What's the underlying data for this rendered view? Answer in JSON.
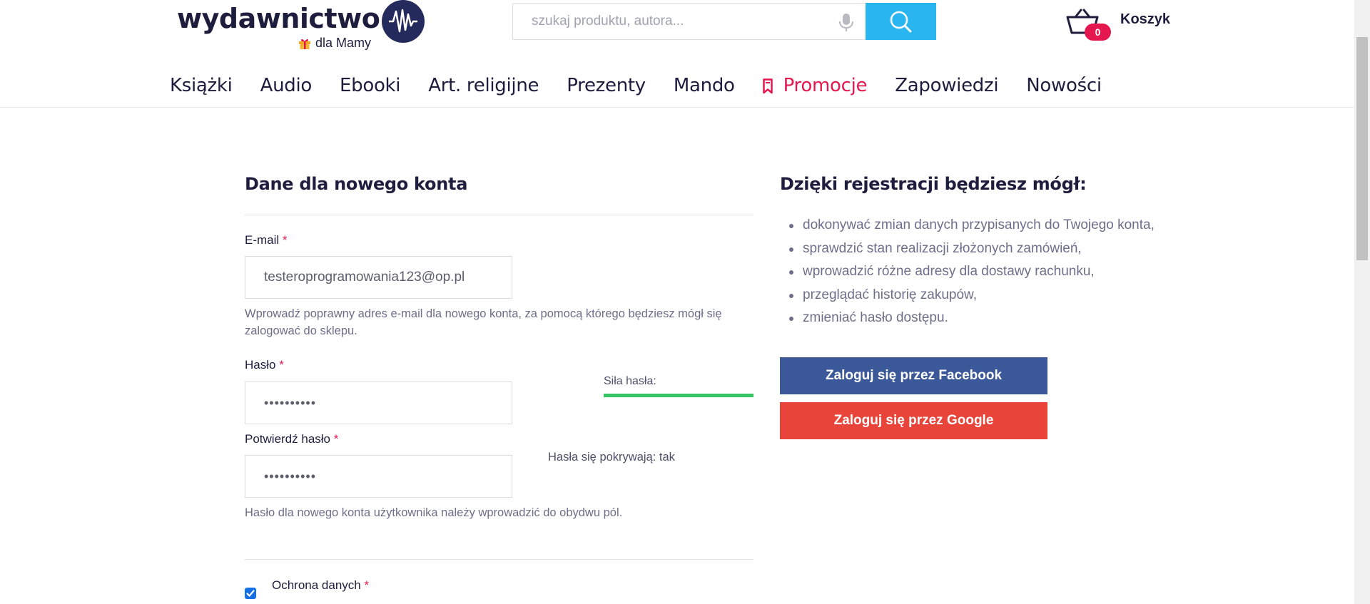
{
  "header": {
    "logo_text": "wydawnictwo",
    "logo_subtitle": "dla Mamy",
    "search": {
      "placeholder": "szukaj produktu, autora..."
    },
    "cart": {
      "label": "Koszyk",
      "count": "0"
    }
  },
  "nav": {
    "items": [
      "Książki",
      "Audio",
      "Ebooki",
      "Art. religijne",
      "Prezenty",
      "Mando",
      "Promocje",
      "Zapowiedzi",
      "Nowości"
    ]
  },
  "form": {
    "title": "Dane dla nowego konta",
    "email": {
      "label": "E-mail",
      "value": "testeroprogramowania123@op.pl",
      "help": "Wprowadź poprawny adres e-mail dla nowego konta, za pomocą którego będziesz mógł się zalogować do sklepu."
    },
    "password": {
      "label": "Hasło",
      "value": "••••••••••",
      "strength_label": "Siła hasła:",
      "strength": 1.0
    },
    "confirm": {
      "label": "Potwierdź hasło",
      "value": "••••••••••",
      "match_text": "Hasła się pokrywają: tak",
      "help": "Hasło dla nowego konta użytkownika należy wprowadzić do obydwu pól."
    },
    "required_mark": "*",
    "privacy": {
      "label": "Ochrona danych",
      "checked": true
    }
  },
  "benefits": {
    "title": "Dzięki rejestracji będziesz mógł:",
    "items": [
      "dokonywać zmian danych przypisanych do Twojego konta,",
      "sprawdzić stan realizacji złożonych zamówień,",
      "wprowadzić różne adresy dla dostawy rachunku,",
      "przeglądać historię zakupów,",
      "zmieniać hasło dostępu."
    ],
    "facebook_button": "Zaloguj się przez Facebook",
    "google_button": "Zaloguj się przez Google"
  },
  "colors": {
    "brand_dark": "#1f1d3d",
    "accent_pink": "#e5174f",
    "search_button": "#29b6f0",
    "facebook": "#3b5898",
    "google": "#e9443a",
    "strength_ok": "#34c463"
  },
  "icons": [
    "logo-wave-icon",
    "gift-icon",
    "microphone-icon",
    "search-icon",
    "basket-icon",
    "bookmark-icon",
    "checkbox-checked-icon"
  ]
}
